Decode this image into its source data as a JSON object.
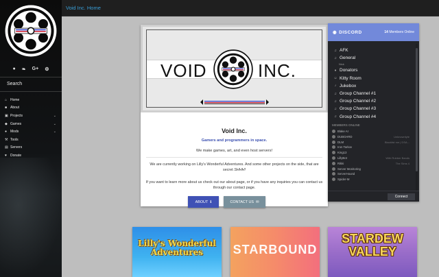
{
  "site": {
    "brand": "Void Inc."
  },
  "topbar": {
    "breadcrumb": "Void Inc. Home"
  },
  "sidebar": {
    "socials": [
      {
        "icon": "github-icon",
        "label": "●"
      },
      {
        "icon": "twitter-icon",
        "label": "❧"
      },
      {
        "icon": "google-plus-icon",
        "label": "G+"
      },
      {
        "icon": "steam-icon",
        "label": "⚙"
      }
    ],
    "search_label": "Search",
    "items": [
      {
        "label": "Home",
        "icon": "home-icon",
        "glyph": "⌂",
        "has_submenu": false
      },
      {
        "label": "About",
        "icon": "chat-icon",
        "glyph": "■",
        "has_submenu": false
      },
      {
        "label": "Projects",
        "icon": "projects-icon",
        "glyph": "▣",
        "has_submenu": true
      },
      {
        "label": "Games",
        "icon": "gamepad-icon",
        "glyph": "◆",
        "has_submenu": true
      },
      {
        "label": "Mods",
        "icon": "mods-icon",
        "glyph": "●",
        "has_submenu": true
      },
      {
        "label": "Tools",
        "icon": "wrench-icon",
        "glyph": "⚒",
        "has_submenu": false
      },
      {
        "label": "Servers",
        "icon": "server-icon",
        "glyph": "▤",
        "has_submenu": false
      },
      {
        "label": "Donate",
        "icon": "heart-icon",
        "glyph": "♥",
        "has_submenu": false
      }
    ]
  },
  "hero": {
    "banner_left": "VOID",
    "banner_right": "INC.",
    "title": "Void Inc.",
    "subtitle": "Gamers and programmers in space.",
    "tagline": "We make games, art, and even host servers!",
    "paragraph1_a": "We are currently working on Lilly's Wonderful Adventures. And some other projects on the side, that are secret ",
    "paragraph1_b": "SHHH!",
    "paragraph2": "If you want to learn more about us check out our about page, or if you have any inquiries you can contact us through our contact page.",
    "about_button": "ABOUT",
    "contact_button": "CONTACT US"
  },
  "discord": {
    "brand": "DISCORD",
    "members_count": "14",
    "members_label": "Members Online",
    "channels": [
      {
        "name": "AFK",
        "glyph": "♫",
        "users": []
      },
      {
        "name": "General",
        "glyph": "♫",
        "users": [
          "Nick"
        ]
      },
      {
        "name": "Donators",
        "glyph": "♦",
        "users": []
      },
      {
        "name": "Kitty Room",
        "glyph": "☺",
        "users": []
      },
      {
        "name": "Jukebox",
        "glyph": "♪",
        "users": []
      },
      {
        "name": "Group Channel #1",
        "glyph": "♫",
        "users": []
      },
      {
        "name": "Group Channel #2",
        "glyph": "♫",
        "users": []
      },
      {
        "name": "Group Channel #3",
        "glyph": "♫",
        "users": []
      },
      {
        "name": "Group Channel #4",
        "glyph": "♫",
        "users": []
      }
    ],
    "members_heading": "MEMBERS ONLINE",
    "members": [
      {
        "name": "Blake AI",
        "game": ""
      },
      {
        "name": "DUBOARD",
        "game": "Unknownlyte"
      },
      {
        "name": "DLM",
        "game": "Blacklist me | DSA..."
      },
      {
        "name": "Iron Tarkov",
        "game": ""
      },
      {
        "name": "King13",
        "game": ""
      },
      {
        "name": "LillyBot",
        "game": "With Rubber Bands"
      },
      {
        "name": "Rikki",
        "game": "The Sims 4"
      },
      {
        "name": "Server Monitoring",
        "game": ""
      },
      {
        "name": "ServerHound",
        "game": ""
      },
      {
        "name": "Spider-M",
        "game": ""
      }
    ],
    "connect_button": "Connect"
  },
  "games": [
    {
      "title": "Lilly's Wonderful Adventures",
      "line1": "Lilly's Wonderful",
      "line2": "Adventures"
    },
    {
      "title": "STARBOUND",
      "line1": "STARBOUND",
      "line2": ""
    },
    {
      "title": "STARDEW VALLEY",
      "line1": "STARDEW",
      "line2": "VALLEY"
    }
  ],
  "colors": {
    "primary": "#3f51b5",
    "secondary": "#78909c",
    "link": "#3aa0d9",
    "discord": "#7289da"
  }
}
